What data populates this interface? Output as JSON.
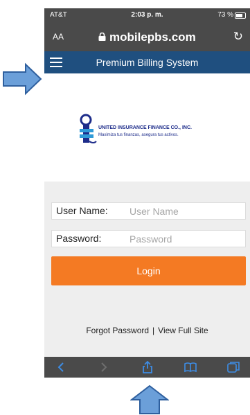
{
  "status_bar": {
    "carrier": "AT&T",
    "time": "2:03 p. m.",
    "battery": "73 %"
  },
  "url_bar": {
    "text_size_label": "AA",
    "url": "mobilepbs.com"
  },
  "navbar": {
    "title": "Premium Billing System"
  },
  "logo": {
    "company_name": "UNITED INSURANCE FINANCE CO., INC.",
    "slogan": "Maximiza tus finanzas, asegura tus activos."
  },
  "login_form": {
    "username_label": "User Name:",
    "username_placeholder": "User Name",
    "password_label": "Password:",
    "password_placeholder": "Password",
    "login_button": "Login"
  },
  "footer_links": {
    "forgot_password": "Forgot Password",
    "separator": "|",
    "view_full_site": "View Full Site"
  },
  "colors": {
    "navbar": "#1f4f7f",
    "login_button": "#f47a23",
    "arrow_fill": "#6b9fd9",
    "arrow_stroke": "#2e5f9e",
    "toolbar_icon": "#3d8de6"
  },
  "icons": {
    "annotation_arrows": [
      "right-arrow-icon",
      "up-arrow-icon"
    ],
    "toolbar": [
      "back-icon",
      "forward-icon",
      "share-icon",
      "bookmarks-icon",
      "tabs-icon"
    ]
  }
}
